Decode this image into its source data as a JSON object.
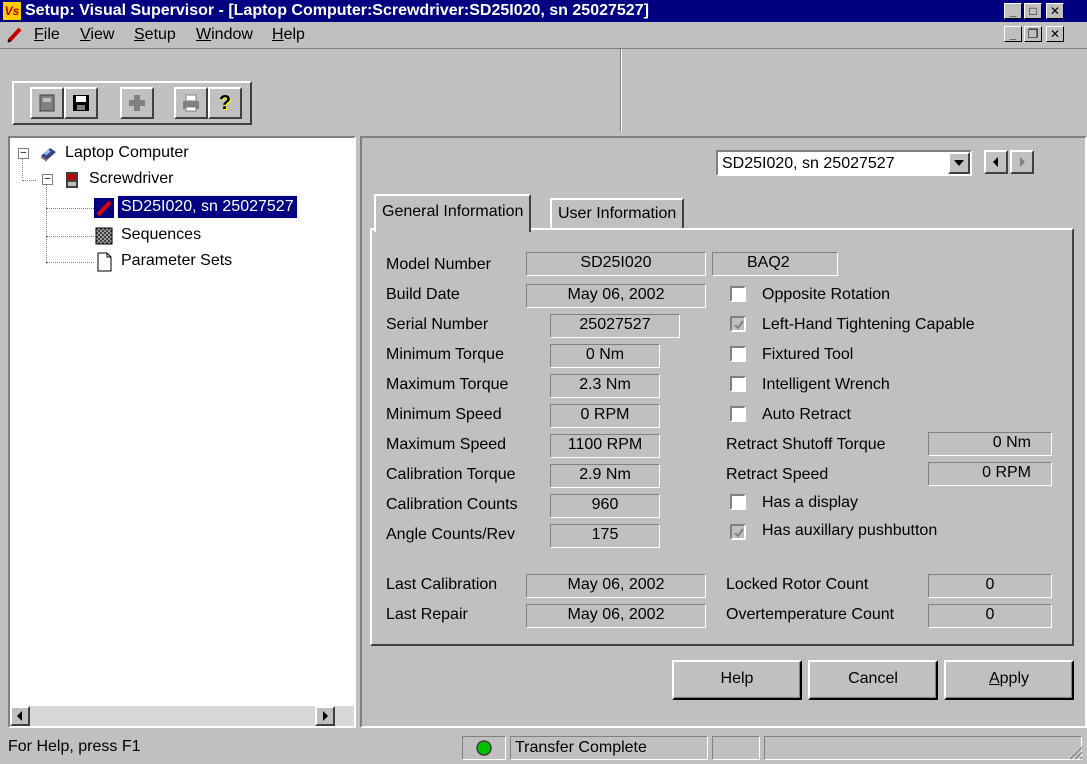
{
  "window": {
    "title": "Setup: Visual Supervisor - [Laptop Computer:Screwdriver:SD25I020, sn 25027527]",
    "app_icon_text": "Vs",
    "controls": {
      "minimize": "_",
      "maximize": "□",
      "close": "✕",
      "restore": "❐"
    }
  },
  "menu": {
    "items": [
      {
        "label": "File",
        "accel": "F",
        "rest": "ile"
      },
      {
        "label": "View",
        "accel": "V",
        "rest": "iew"
      },
      {
        "label": "Setup",
        "accel": "S",
        "rest": "etup"
      },
      {
        "label": "Window",
        "accel": "W",
        "rest": "indow"
      },
      {
        "label": "Help",
        "accel": "H",
        "rest": "elp"
      }
    ]
  },
  "toolbar": {
    "buttons": [
      "open-icon",
      "save-icon",
      "add-icon",
      "print-icon",
      "help-icon"
    ],
    "help_glyph": "?"
  },
  "tree": {
    "items": [
      {
        "label": "Laptop Computer",
        "icon": "laptop-icon",
        "expander": "−"
      },
      {
        "label": "Screwdriver",
        "icon": "screwdriver-icon",
        "expander": "−"
      },
      {
        "label": "SD25I020, sn 25027527",
        "icon": "tool-icon",
        "selected": true
      },
      {
        "label": "Sequences",
        "icon": "sequences-icon"
      },
      {
        "label": "Parameter Sets",
        "icon": "document-icon"
      }
    ]
  },
  "device_selector": {
    "value": "SD25I020, sn 25027527"
  },
  "tabs": [
    {
      "label": "General Information",
      "active": true
    },
    {
      "label": "User Information",
      "active": false
    }
  ],
  "general": {
    "model_number": {
      "label": "Model Number",
      "value": "SD25I020",
      "extra": "BAQ2"
    },
    "build_date": {
      "label": "Build Date",
      "value": "May 06, 2002"
    },
    "serial_number": {
      "label": "Serial Number",
      "value": "25027527"
    },
    "minimum_torque": {
      "label": "Minimum Torque",
      "value": "0 Nm"
    },
    "maximum_torque": {
      "label": "Maximum Torque",
      "value": "2.3 Nm"
    },
    "minimum_speed": {
      "label": "Minimum Speed",
      "value": "0 RPM"
    },
    "maximum_speed": {
      "label": "Maximum Speed",
      "value": "1100 RPM"
    },
    "calibration_torque": {
      "label": "Calibration Torque",
      "value": "2.9 Nm"
    },
    "calibration_counts": {
      "label": "Calibration Counts",
      "value": "960"
    },
    "angle_counts": {
      "label": "Angle Counts/Rev",
      "value": "175"
    },
    "last_calibration": {
      "label": "Last Calibration",
      "value": "May 06, 2002"
    },
    "last_repair": {
      "label": "Last Repair",
      "value": "May 06, 2002"
    },
    "checkboxes": [
      {
        "label": "Opposite Rotation",
        "checked": false,
        "enabled": true
      },
      {
        "label": "Left-Hand Tightening Capable",
        "checked": true,
        "enabled": false
      },
      {
        "label": "Fixtured Tool",
        "checked": false,
        "enabled": true
      },
      {
        "label": "Intelligent Wrench",
        "checked": false,
        "enabled": true
      },
      {
        "label": "Auto Retract",
        "checked": false,
        "enabled": true
      }
    ],
    "retract_shutoff_torque": {
      "label": "Retract Shutoff Torque",
      "value": "0 Nm"
    },
    "retract_speed": {
      "label": "Retract Speed",
      "value": "0 RPM"
    },
    "checkboxes2": [
      {
        "label": "Has a display",
        "checked": false,
        "enabled": true
      },
      {
        "label": "Has auxillary pushbutton",
        "checked": true,
        "enabled": false
      }
    ],
    "locked_rotor_count": {
      "label": "Locked Rotor Count",
      "value": "0"
    },
    "overtemperature_count": {
      "label": "Overtemperature Count",
      "value": "0"
    }
  },
  "buttons": {
    "help": "Help",
    "cancel": "Cancel",
    "apply": "Apply",
    "apply_accel": "A",
    "apply_rest": "pply"
  },
  "status": {
    "help_text": "For Help, press F1",
    "transfer": "Transfer Complete",
    "indicator_color": "#00c000"
  }
}
